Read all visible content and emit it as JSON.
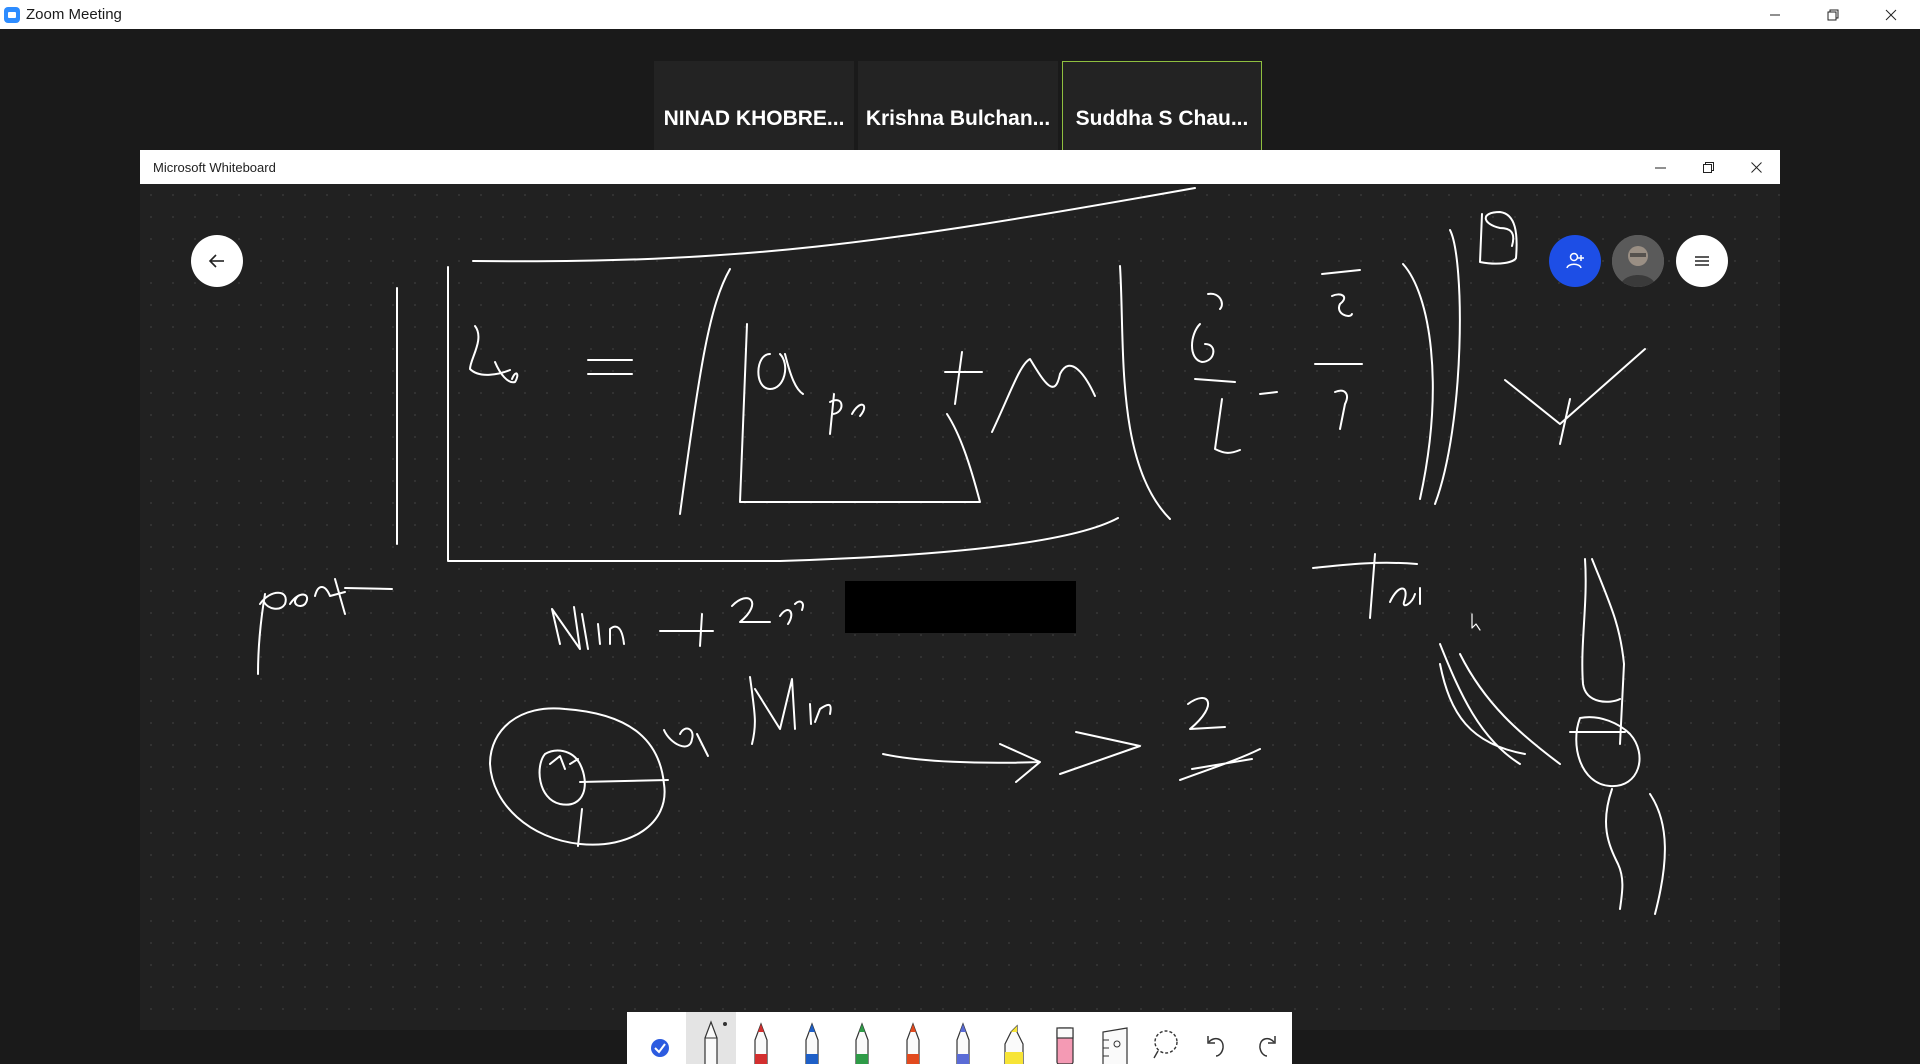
{
  "zoom": {
    "title": "Zoom Meeting",
    "participants": [
      {
        "name": "NINAD  KHOBRE...",
        "active": false
      },
      {
        "name": "Krishna  Bulchan...",
        "active": false
      },
      {
        "name": "Suddha S Chau...",
        "active": true
      }
    ]
  },
  "whiteboard": {
    "title": "Microsoft Whiteboard",
    "toolbar": {
      "tools": [
        {
          "name": "select-tool-icon"
        },
        {
          "name": "pencil-tool-icon",
          "selected": true
        },
        {
          "name": "red-pen-icon",
          "color": "#d32f2f"
        },
        {
          "name": "blue-pen-icon",
          "color": "#1e5fc7"
        },
        {
          "name": "green-pen-icon",
          "color": "#2e9b47"
        },
        {
          "name": "orange-red-pen-icon",
          "color": "#e24a1e"
        },
        {
          "name": "purple-pen-icon",
          "color": "#5a6bd6"
        },
        {
          "name": "highlighter-icon",
          "color": "#f7e436"
        },
        {
          "name": "eraser-icon",
          "color": "#f49ab4"
        },
        {
          "name": "ruler-icon"
        },
        {
          "name": "lasso-icon"
        },
        {
          "name": "undo-icon"
        },
        {
          "name": "redo-icon"
        }
      ]
    }
  },
  "colors": {
    "accent": "#1d4ee6",
    "active_speaker_border": "#8fbf3f",
    "canvas": "#212121"
  }
}
